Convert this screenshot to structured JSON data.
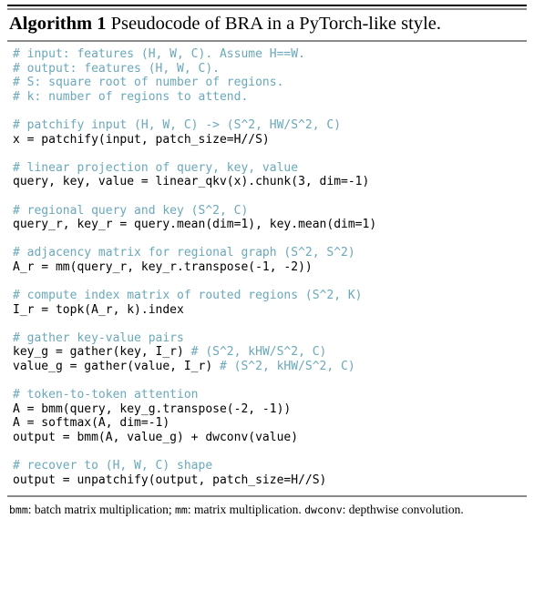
{
  "algorithm": {
    "label": "Algorithm 1",
    "title": " Pseudocode of BRA in a PyTorch-like style.",
    "comment_color": "#6aa8ba",
    "code_color": "#000000",
    "rule_color": "#8a8a8a",
    "lines": [
      {
        "type": "comment",
        "text": "# input: features (H, W, C). Assume H==W."
      },
      {
        "type": "comment",
        "text": "# output: features (H, W, C)."
      },
      {
        "type": "comment",
        "text": "# S: square root of number of regions."
      },
      {
        "type": "comment",
        "text": "# k: number of regions to attend."
      },
      {
        "type": "blank",
        "text": ""
      },
      {
        "type": "comment",
        "text": "# patchify input (H, W, C) -> (S^2, HW/S^2, C)"
      },
      {
        "type": "code",
        "text": "x = patchify(input, patch_size=H//S)"
      },
      {
        "type": "blank",
        "text": ""
      },
      {
        "type": "comment",
        "text": "# linear projection of query, key, value"
      },
      {
        "type": "code",
        "text": "query, key, value = linear_qkv(x).chunk(3, dim=-1)"
      },
      {
        "type": "blank",
        "text": ""
      },
      {
        "type": "comment",
        "text": "# regional query and key (S^2, C)"
      },
      {
        "type": "code",
        "text": "query_r, key_r = query.mean(dim=1), key.mean(dim=1)"
      },
      {
        "type": "blank",
        "text": ""
      },
      {
        "type": "comment",
        "text": "# adjacency matrix for regional graph (S^2, S^2)"
      },
      {
        "type": "code",
        "text": "A_r = mm(query_r, key_r.transpose(-1, -2))"
      },
      {
        "type": "blank",
        "text": ""
      },
      {
        "type": "comment",
        "text": "# compute index matrix of routed regions (S^2, K)"
      },
      {
        "type": "code",
        "text": "I_r = topk(A_r, k).index"
      },
      {
        "type": "blank",
        "text": ""
      },
      {
        "type": "comment",
        "text": "# gather key-value pairs"
      },
      {
        "type": "mixed",
        "code": "key_g = gather(key, I_r) ",
        "comment": "# (S^2, kHW/S^2, C)"
      },
      {
        "type": "mixed",
        "code": "value_g = gather(value, I_r) ",
        "comment": "# (S^2, kHW/S^2, C)"
      },
      {
        "type": "blank",
        "text": ""
      },
      {
        "type": "comment",
        "text": "# token-to-token attention"
      },
      {
        "type": "code",
        "text": "A = bmm(query, key_g.transpose(-2, -1))"
      },
      {
        "type": "code",
        "text": "A = softmax(A, dim=-1)"
      },
      {
        "type": "code",
        "text": "output = bmm(A, value_g) + dwconv(value)"
      },
      {
        "type": "blank",
        "text": ""
      },
      {
        "type": "comment",
        "text": "# recover to (H, W, C) shape"
      },
      {
        "type": "code",
        "text": "output = unpatchify(output, patch_size=H//S)"
      }
    ],
    "footnote": {
      "term1": "bmm",
      "text1": ": batch matrix multiplication; ",
      "term2": "mm",
      "text2": ": matrix multiplication. ",
      "term3": "dwconv",
      "text3": ": depthwise convolution."
    }
  }
}
